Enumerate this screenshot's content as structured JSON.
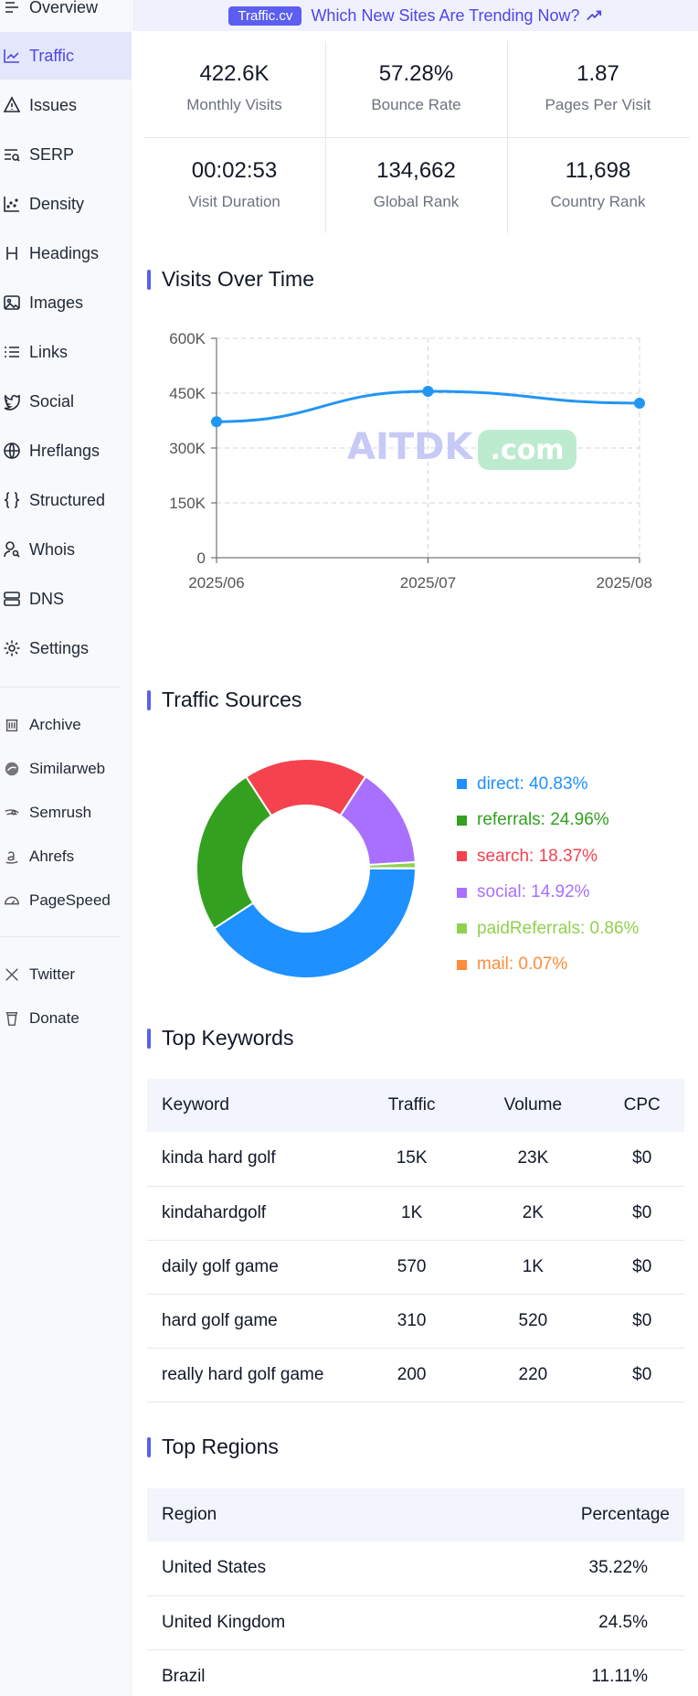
{
  "sidebar": {
    "items": [
      {
        "label": "Overview",
        "icon": "overview-icon"
      },
      {
        "label": "Traffic",
        "icon": "traffic-icon",
        "active": true
      },
      {
        "label": "Issues",
        "icon": "warning-icon"
      },
      {
        "label": "SERP",
        "icon": "serp-icon"
      },
      {
        "label": "Density",
        "icon": "density-icon"
      },
      {
        "label": "Headings",
        "icon": "heading-icon"
      },
      {
        "label": "Images",
        "icon": "image-icon"
      },
      {
        "label": "Links",
        "icon": "links-icon"
      },
      {
        "label": "Social",
        "icon": "twitter-bird-icon"
      },
      {
        "label": "Hreflangs",
        "icon": "globe-icon"
      },
      {
        "label": "Structured",
        "icon": "braces-icon"
      },
      {
        "label": "Whois",
        "icon": "user-search-icon"
      },
      {
        "label": "DNS",
        "icon": "server-icon"
      },
      {
        "label": "Settings",
        "icon": "gear-icon"
      }
    ],
    "external": [
      {
        "label": "Archive",
        "icon": "archive-icon"
      },
      {
        "label": "Similarweb",
        "icon": "similarweb-icon"
      },
      {
        "label": "Semrush",
        "icon": "semrush-icon"
      },
      {
        "label": "Ahrefs",
        "icon": "ahrefs-icon"
      },
      {
        "label": "PageSpeed",
        "icon": "gauge-icon"
      }
    ],
    "social": [
      {
        "label": "Twitter",
        "icon": "x-logo-icon"
      },
      {
        "label": "Donate",
        "icon": "cup-icon"
      }
    ]
  },
  "banner": {
    "badge": "Traffic.cv",
    "link": "Which New Sites Are Trending Now?"
  },
  "stats": [
    {
      "value": "422.6K",
      "label": "Monthly Visits"
    },
    {
      "value": "57.28%",
      "label": "Bounce Rate"
    },
    {
      "value": "1.87",
      "label": "Pages Per Visit"
    },
    {
      "value": "00:02:53",
      "label": "Visit Duration"
    },
    {
      "value": "134,662",
      "label": "Global Rank"
    },
    {
      "value": "11,698",
      "label": "Country Rank"
    }
  ],
  "sections": {
    "visits": "Visits Over Time",
    "sources": "Traffic Sources",
    "keywords": "Top Keywords",
    "regions": "Top Regions"
  },
  "watermark": {
    "text": "AITDK",
    "suffix": ".com"
  },
  "chart_data": [
    {
      "type": "line",
      "title": "Visits Over Time",
      "x": [
        "2025/06",
        "2025/07",
        "2025/08"
      ],
      "series": [
        {
          "values": [
            372000,
            455000,
            422600
          ]
        }
      ],
      "ylim": [
        0,
        600000
      ],
      "yticks": [
        "0",
        "150K",
        "300K",
        "450K",
        "600K"
      ],
      "grid": true,
      "color": "#2196f3"
    },
    {
      "type": "pie",
      "title": "Traffic Sources",
      "donut": true,
      "categories": [
        "direct",
        "referrals",
        "search",
        "social",
        "paidReferrals",
        "mail"
      ],
      "values": [
        40.83,
        24.96,
        18.37,
        14.92,
        0.86,
        0.07
      ],
      "colors": [
        "#1e90ff",
        "#34a020",
        "#f5424f",
        "#a970ff",
        "#8fd14f",
        "#ff8c3a"
      ],
      "labels": [
        "direct: 40.83%",
        "referrals: 24.96%",
        "search: 18.37%",
        "social: 14.92%",
        "paidReferrals: 0.86%",
        "mail: 0.07%"
      ],
      "legend": "right"
    }
  ],
  "keywords": {
    "headers": [
      "Keyword",
      "Traffic",
      "Volume",
      "CPC"
    ],
    "rows": [
      [
        "kinda hard golf",
        "15K",
        "23K",
        "$0"
      ],
      [
        "kindahardgolf",
        "1K",
        "2K",
        "$0"
      ],
      [
        "daily golf game",
        "570",
        "1K",
        "$0"
      ],
      [
        "hard golf game",
        "310",
        "520",
        "$0"
      ],
      [
        "really hard golf game",
        "200",
        "220",
        "$0"
      ]
    ]
  },
  "regions": {
    "headers": [
      "Region",
      "Percentage"
    ],
    "rows": [
      [
        "United States",
        "35.22%"
      ],
      [
        "United Kingdom",
        "24.5%"
      ],
      [
        "Brazil",
        "11.11%"
      ]
    ]
  }
}
